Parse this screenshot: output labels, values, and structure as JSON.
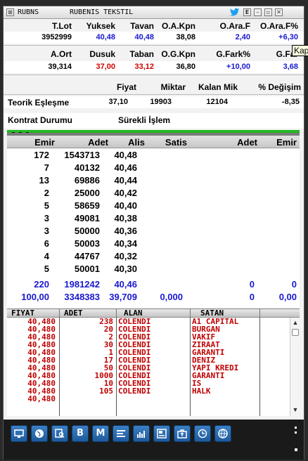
{
  "window": {
    "symbol": "RUBNS",
    "name": "RUBENIS TEKSTIL",
    "icons": [
      "twitter-icon",
      "e-icon",
      "minimize-icon",
      "restore-icon",
      "close-icon"
    ]
  },
  "summary": {
    "row1_headers": [
      "T.Lot",
      "Yuksek",
      "Tavan",
      "O.A.Kpn",
      "O.Ara.F",
      "O.Ara.F%"
    ],
    "row1_values": [
      "3952999",
      "40,48",
      "40,48",
      "38,08",
      "2,40",
      "+6,30"
    ],
    "row2_headers": [
      "A.Ort",
      "Dusuk",
      "Taban",
      "O.G.Kpn",
      "G.Fark%",
      "G.Far"
    ],
    "row2_values": [
      "39,314",
      "37,00",
      "33,12",
      "36,80",
      "+10,00",
      "3,68"
    ],
    "row3_headers": [
      "Fiyat",
      "Miktar",
      "Kalan Mik",
      "% Değişim"
    ],
    "teorik_label": "Teorik Eşleşme",
    "teorik_values": [
      "37,10",
      "19903",
      "12104",
      "-8,35"
    ],
    "kontrat_label": "Kontrat Durumu",
    "kontrat_value": "Sürekli İşlem",
    "tooltip": "Kap"
  },
  "colors": {
    "blue": "#1818d0",
    "red": "#d00000",
    "trade_red": "#c00000",
    "green_bar": "#22b822"
  },
  "orderbook": {
    "headers": [
      "Emir",
      "Adet",
      "Alis",
      "Satis",
      "Adet",
      "Emir"
    ],
    "rows": [
      [
        "172",
        "1543713",
        "40,48"
      ],
      [
        "7",
        "40132",
        "40,46"
      ],
      [
        "13",
        "69886",
        "40,44"
      ],
      [
        "2",
        "25000",
        "40,42"
      ],
      [
        "5",
        "58659",
        "40,40"
      ],
      [
        "3",
        "49081",
        "40,38"
      ],
      [
        "3",
        "50000",
        "40,36"
      ],
      [
        "6",
        "50003",
        "40,34"
      ],
      [
        "4",
        "44767",
        "40,32"
      ],
      [
        "5",
        "50001",
        "40,30"
      ]
    ],
    "total1": [
      "220",
      "1981242",
      "40,46",
      "",
      "0",
      "0"
    ],
    "total2": [
      "100,00",
      "3348383",
      "39,709",
      "0,000",
      "0",
      "0,00"
    ]
  },
  "trades": {
    "headers": [
      "FIYAT",
      "ADET",
      "ALAN",
      "SATAN"
    ],
    "rows": [
      [
        "40,480",
        "238",
        "COLENDI",
        "A1 CAPITAL"
      ],
      [
        "40,480",
        "20",
        "COLENDI",
        "BURGAN"
      ],
      [
        "40,480",
        "2",
        "COLENDI",
        "VAKIF"
      ],
      [
        "40,480",
        "30",
        "COLENDI",
        "ZIRAAT"
      ],
      [
        "40,480",
        "1",
        "COLENDI",
        "GARANTI"
      ],
      [
        "40,480",
        "17",
        "COLENDI",
        "DENIZ"
      ],
      [
        "40,480",
        "50",
        "COLENDI",
        "YAPI KREDI"
      ],
      [
        "40,480",
        "1000",
        "COLENDI",
        "GARANTI"
      ],
      [
        "40,480",
        "10",
        "COLENDI",
        "IS"
      ],
      [
        "40,480",
        "105",
        "COLENDI",
        "HALK"
      ],
      [
        "40,480",
        "",
        "",
        ""
      ]
    ]
  },
  "toolbar": {
    "buttons": [
      "monitor-icon",
      "globe-icon",
      "chart-search-icon",
      "B",
      "M",
      "list-icon",
      "bar-chart-icon",
      "news-icon",
      "portfolio-icon",
      "clock-icon",
      "browser-icon"
    ]
  }
}
